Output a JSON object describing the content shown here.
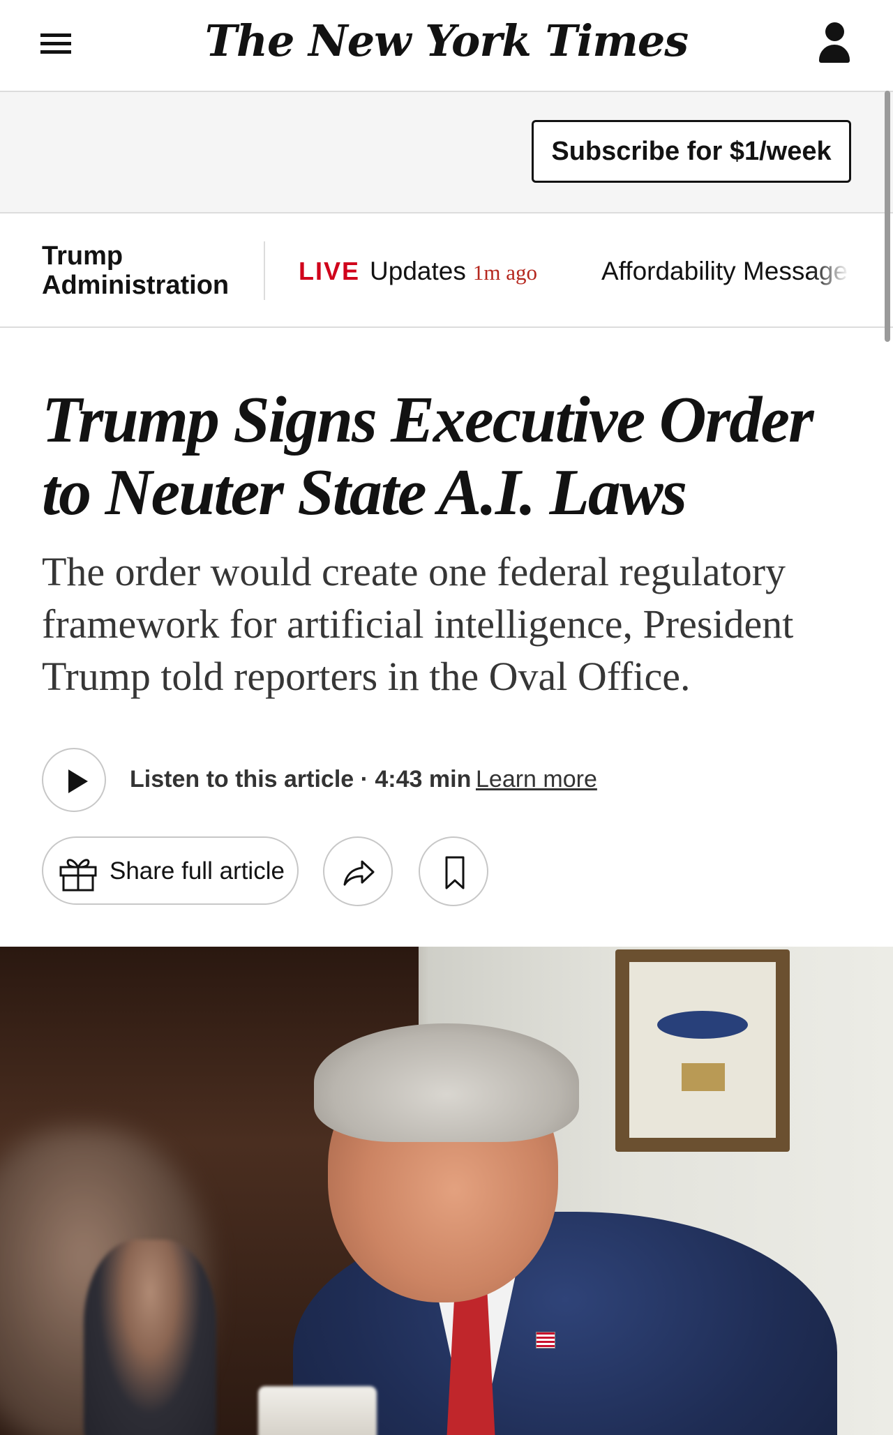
{
  "header": {
    "logo_text": "The New York Times",
    "menu_icon": "hamburger-menu-icon",
    "account_icon": "user-account-icon"
  },
  "subscribe": {
    "label": "Subscribe for $1/week"
  },
  "section_nav": {
    "section_title": "Trump Administration",
    "live_label": "LIVE",
    "live_title": "Updates",
    "live_time": "1m ago",
    "next_link": "Affordability Message"
  },
  "article": {
    "headline": "Trump Signs Executive Order to Neuter State A.I. Laws",
    "summary": "The order would create one federal regulatory framework for artificial intelligence, President Trump told reporters in the Oval Office."
  },
  "audio": {
    "listen_text": "Listen to this article · 4:43 min",
    "learn_more": "Learn more"
  },
  "share": {
    "share_full_label": "Share full article",
    "share_icon": "share-arrow-icon",
    "save_icon": "bookmark-icon",
    "gift_icon": "gift-icon"
  },
  "colors": {
    "live_red": "#d0021b",
    "text": "#121212",
    "divider": "#dcdcdc",
    "subbar_bg": "#f5f5f5"
  }
}
